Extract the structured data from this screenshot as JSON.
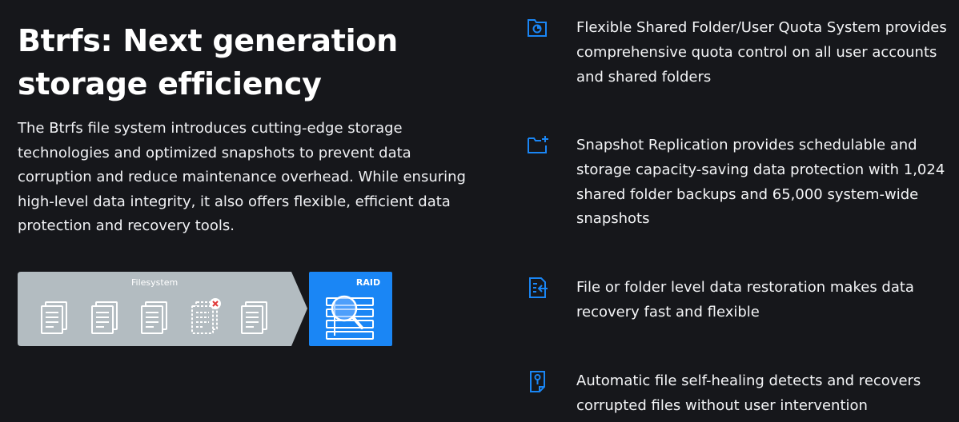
{
  "hero": {
    "title": "Btrfs: Next generation storage efficiency",
    "description": "The Btrfs file system introduces cutting-edge storage technologies and optimized snapshots to prevent data corruption and reduce maintenance overhead. While ensuring high-level data integrity, it also offers flexible, efficient data protection and recovery tools."
  },
  "diagram": {
    "filesystem_label": "Filesystem",
    "raid_label": "RAID",
    "colors": {
      "filesystem_bg": "#b3bcc1",
      "raid_bg": "#1a86f5",
      "error_badge": "#e03a3a"
    }
  },
  "features": [
    {
      "icon": "folder-quota-icon",
      "text": "Flexible Shared Folder/User Quota System provides comprehensive quota control on all user accounts and shared folders"
    },
    {
      "icon": "snapshot-folder-icon",
      "text": "Snapshot Replication provides schedulable and storage capacity-saving data protection with 1,024 shared folder backups and 65,000 system-wide snapshots"
    },
    {
      "icon": "file-restore-icon",
      "text": "File or folder level data restoration makes data recovery fast and flexible"
    },
    {
      "icon": "self-healing-file-icon",
      "text": "Automatic file self-healing detects and recovers corrupted files without user intervention"
    }
  ],
  "colors": {
    "background": "#16171b",
    "accent": "#1a86f5",
    "text": "#ffffff"
  }
}
